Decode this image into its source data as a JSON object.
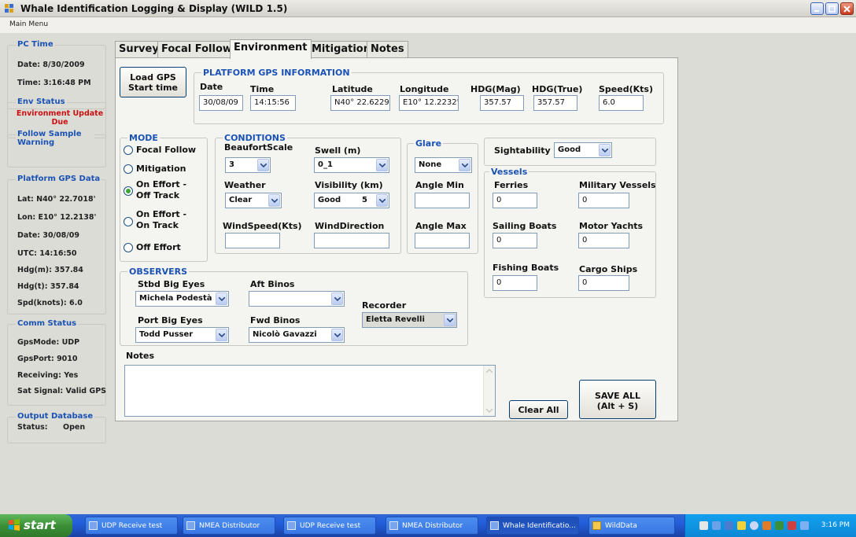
{
  "window": {
    "title": "Whale Identification Logging & Display (WILD 1.5)",
    "menu": "Main Menu"
  },
  "sidebar": {
    "pc_time": {
      "title": "PC Time",
      "date": "Date: 8/30/2009",
      "time": "Time: 3:16:48 PM"
    },
    "env_status": {
      "title": "Env Status",
      "message": "Environment Update Due"
    },
    "follow_sample": {
      "title": "Follow Sample Warning"
    },
    "platform_gps": {
      "title": "Platform GPS Data",
      "lat": "Lat:  N40° 22.7018'",
      "lon": "Lon:  E10° 12.2138'",
      "date": "Date: 30/08/09",
      "utc": "UTC:  14:16:50",
      "hdgm": "Hdg(m): 357.84",
      "hdgt": "Hdg(t):  357.84",
      "spd": "Spd(knots): 6.0"
    },
    "comm_status": {
      "title": "Comm Status",
      "gpsmode": "GpsMode:  UDP",
      "gpsport": "GpsPort:     9010",
      "receiving": "Receiving:  Yes",
      "sat": "Sat Signal:  Valid GPS"
    },
    "output_db": {
      "title": "Output Database",
      "status_label": "Status:",
      "status_value": "Open"
    }
  },
  "tabs": [
    "Survey",
    "Focal Follow",
    "Environment",
    "Mitigation",
    "Notes"
  ],
  "gps_info": {
    "load_button": "Load GPS Start time",
    "title": "PLATFORM GPS INFORMATION",
    "labels": {
      "date": "Date",
      "time": "Time",
      "lat": "Latitude",
      "lon": "Longitude",
      "hdgmag": "HDG(Mag)",
      "hdgtrue": "HDG(True)",
      "speed": "Speed(Kts)"
    },
    "values": {
      "date": "30/08/09",
      "time": "14:15:56",
      "lat": "N40° 22.6229'",
      "lon": "E10° 12.2232'",
      "hdgmag": "357.57",
      "hdgtrue": "357.57",
      "speed": "6.0"
    }
  },
  "mode": {
    "title": "MODE",
    "options": [
      "Focal Follow",
      "Mitigation",
      "On Effort - Off Track",
      "On Effort - On Track",
      "Off Effort"
    ],
    "selected": "On Effort - Off Track"
  },
  "conditions": {
    "title": "CONDITIONS",
    "beaufort_label": "BeaufortScale",
    "beaufort": "3",
    "swell_label": "Swell (m)",
    "swell": "0_1",
    "weather_label": "Weather",
    "weather": "Clear",
    "visibility_label": "Visibility (km)",
    "visibility": "Good",
    "visibility_num": "5",
    "windspeed_label": "WindSpeed(Kts)",
    "windspeed": "",
    "winddir_label": "WindDirection",
    "winddir": ""
  },
  "glare": {
    "title": "Glare",
    "value": "None",
    "angle_min_label": "Angle Min",
    "angle_min": "",
    "angle_max_label": "Angle Max",
    "angle_max": ""
  },
  "sightability": {
    "label": "Sightability",
    "value": "Good"
  },
  "vessels": {
    "title": "Vessels",
    "ferries_label": "Ferries",
    "ferries": "0",
    "military_label": "Military Vessels",
    "military": "0",
    "sailing_label": "Sailing Boats",
    "sailing": "0",
    "motor_label": "Motor Yachts",
    "motor": "0",
    "fishing_label": "Fishing Boats",
    "fishing": "0",
    "cargo_label": "Cargo Ships",
    "cargo": "0"
  },
  "observers": {
    "title": "OBSERVERS",
    "stbd_label": "Stbd Big Eyes",
    "stbd": "Michela Podestà",
    "aft_label": "Aft Binos",
    "aft": "",
    "recorder_label": "Recorder",
    "recorder": "Eletta Revelli",
    "port_label": "Port Big Eyes",
    "port": "Todd Pusser",
    "fwd_label": "Fwd Binos",
    "fwd": "Nicolò Gavazzi"
  },
  "notes": {
    "label": "Notes",
    "value": ""
  },
  "buttons": {
    "clear_all": "Clear All",
    "save_all": "SAVE ALL (Alt + S)"
  },
  "taskbar": {
    "start": "start",
    "tasks": [
      "UDP Receive test",
      "NMEA Distributor",
      "UDP Receive test",
      "NMEA Distributor",
      "Whale Identificatio...",
      "WildData"
    ],
    "clock": "3:16 PM"
  }
}
